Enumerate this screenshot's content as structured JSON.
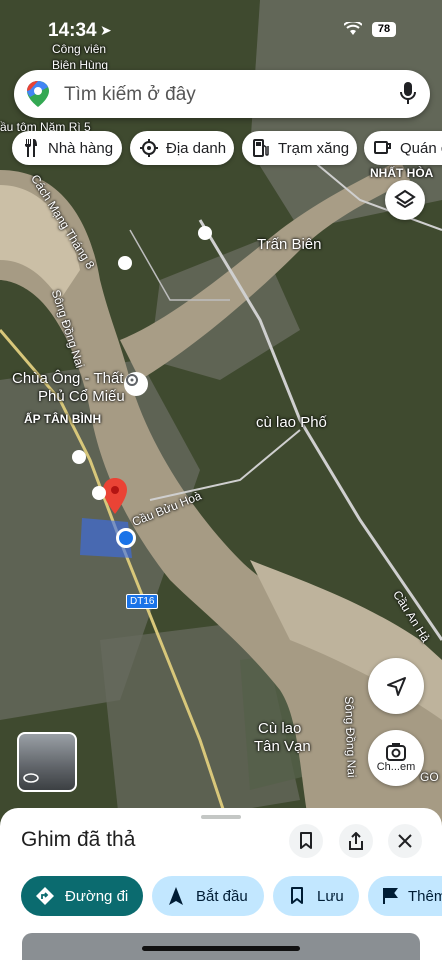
{
  "status": {
    "time": "14:34",
    "battery": "78"
  },
  "search": {
    "placeholder": "Tìm kiếm ở đây"
  },
  "chips": [
    {
      "label": "Nhà hàng",
      "icon": "fork-knife-icon"
    },
    {
      "label": "Địa danh",
      "icon": "landmark-icon"
    },
    {
      "label": "Trạm xăng",
      "icon": "gas-station-icon"
    },
    {
      "label": "Quán c",
      "icon": "coffee-icon"
    }
  ],
  "map_labels": {
    "park": "Công viên",
    "park2": "Biên Hùng",
    "shop": "ầu tôm Năm Rì 5",
    "street1": "Cách Mạng Tháng 8",
    "district": "NHẤT HÒA",
    "tranbien": "Trấn Biên",
    "river1": "Sông Đồng Nai",
    "temple1": "Chùa Ông - Thất",
    "temple2": "Phủ Cổ Miếu",
    "hamlet": "ẤP TÂN BÌNH",
    "island1": "cù lao Phố",
    "bridge1": "Cầu Bửu Hoà",
    "road_dt16": "DT16",
    "bridge2": "Cầu An Hả",
    "island2a": "Cù lao",
    "island2b": "Tân Vạn",
    "river2": "Sông Đồng Nai",
    "go": "GO"
  },
  "camera_label": "Ch...em",
  "sheet": {
    "title": "Ghim đã thả",
    "actions": [
      {
        "label": "Đường đi",
        "icon": "directions-icon"
      },
      {
        "label": "Bắt đầu",
        "icon": "navigation-arrow-icon"
      },
      {
        "label": "Lưu",
        "icon": "bookmark-icon"
      },
      {
        "label": "Thêm",
        "icon": "flag-icon"
      }
    ]
  },
  "colors": {
    "accent": "#0b57d0",
    "primary_button": "#0b6b6f",
    "secondary_button": "#c2e7ff",
    "pin": "#ea4335"
  }
}
